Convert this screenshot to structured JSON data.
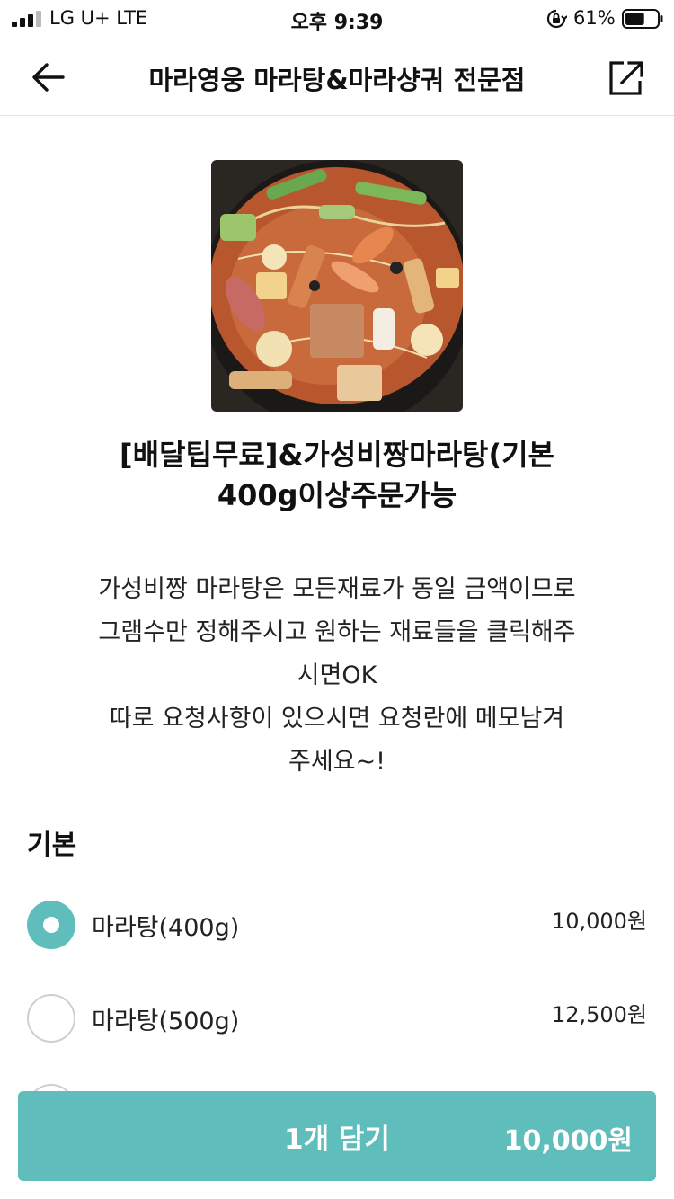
{
  "status_bar": {
    "carrier": "LG U+  LTE",
    "time": "오후 9:39",
    "battery": "61%",
    "battery_level": 0.61
  },
  "header": {
    "title": "마라영웅 마라탕&마라샹궈 전문점",
    "back_icon": "arrow-left-icon",
    "share_icon": "share-external-icon"
  },
  "product": {
    "name_line1": "[배달팁무료]&가성비짱마라탕(기본",
    "name_line2": "400g이상주문가능",
    "description": "가성비짱 마라탕은 모든재료가 동일 금액이므로\n그램수만 정해주시고 원하는 재료들을 클릭해주\n시면OK\n따로 요청사항이 있으시면 요청란에 메모남겨\n주세요~!"
  },
  "options": {
    "section_title": "기본",
    "items": [
      {
        "label": "마라탕(400g)",
        "price": "10,000원",
        "selected": true
      },
      {
        "label": "마라탕(500g)",
        "price": "12,500원",
        "selected": false
      }
    ]
  },
  "cart_button": {
    "label": "1개 담기",
    "total": "10,000원"
  },
  "colors": {
    "accent": "#5fbdbb",
    "text": "#111111",
    "divider": "#e3e3e3"
  }
}
